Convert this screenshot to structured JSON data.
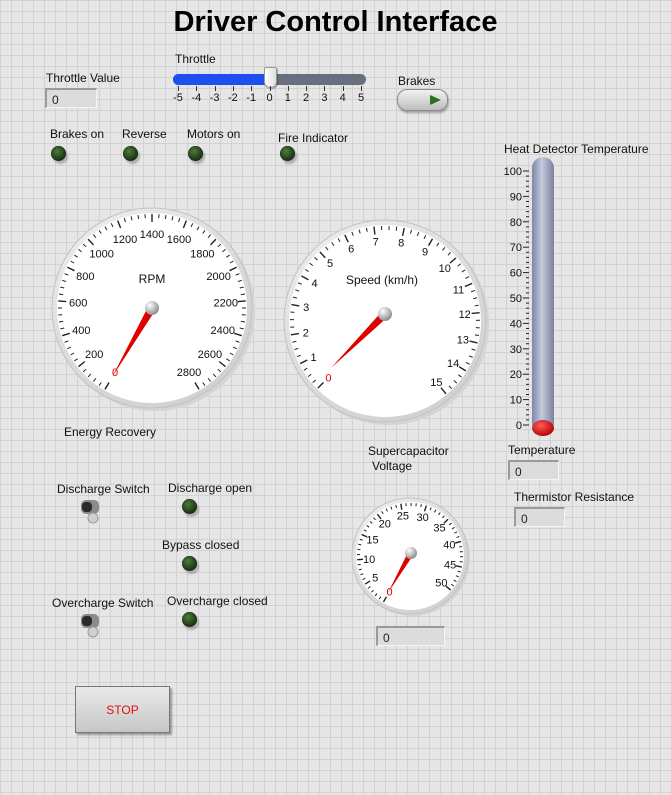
{
  "title": "Driver Control Interface",
  "throttle": {
    "value_label": "Throttle Value",
    "value": "0",
    "slider_label": "Throttle",
    "slider_value": 0,
    "min": -5,
    "max": 5,
    "ticks": [
      "-5",
      "-4",
      "-3",
      "-2",
      "-1",
      "0",
      "1",
      "2",
      "3",
      "4",
      "5"
    ]
  },
  "brakes": {
    "label": "Brakes"
  },
  "indicators": {
    "brakes_on": "Brakes on",
    "reverse": "Reverse",
    "motors_on": "Motors on",
    "fire": "Fire Indicator"
  },
  "rpm_gauge": {
    "label": "RPM",
    "value": 0,
    "ticks": [
      "0",
      "200",
      "400",
      "600",
      "800",
      "1000",
      "1200",
      "1400",
      "1600",
      "1800",
      "2000",
      "2200",
      "2400",
      "2600",
      "2800"
    ]
  },
  "speed_gauge": {
    "label": "Speed (km/h)",
    "value": 0,
    "ticks": [
      "0",
      "1",
      "2",
      "3",
      "4",
      "5",
      "6",
      "7",
      "8",
      "9",
      "10",
      "11",
      "12",
      "13",
      "14",
      "15"
    ]
  },
  "heat": {
    "label": "Heat Detector Temperature",
    "value": 0,
    "ticks": [
      "100",
      "90",
      "80",
      "70",
      "60",
      "50",
      "40",
      "30",
      "20",
      "10",
      "0"
    ],
    "temperature_label": "Temperature",
    "temperature_value": "0",
    "resistance_label": "Thermistor Resistance",
    "resistance_value": "0"
  },
  "energy": {
    "title": "Energy Recovery",
    "discharge_switch": "Discharge Switch",
    "discharge_open": "Discharge open",
    "bypass_closed": "Bypass closed",
    "overcharge_switch": "Overcharge Switch",
    "overcharge_closed": "Overcharge closed"
  },
  "supercap": {
    "label_line1": "Supercapacitor",
    "label_line2": "Voltage",
    "value": "0",
    "ticks": [
      "0",
      "5",
      "10",
      "15",
      "20",
      "25",
      "30",
      "35",
      "40",
      "45",
      "50"
    ]
  },
  "stop": {
    "label": "STOP"
  },
  "colors": {
    "needle": "#e00000",
    "slider_fill": "#1c4ef0",
    "stop_text": "#e01010",
    "led_off": "#1f3c17"
  }
}
